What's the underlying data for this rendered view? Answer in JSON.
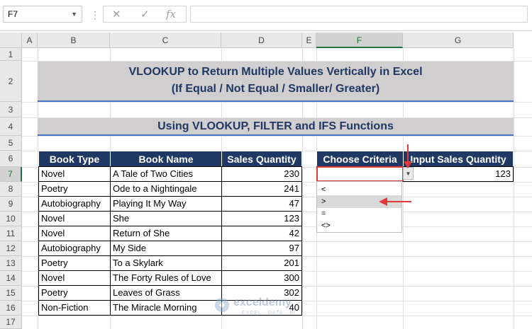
{
  "formula_bar": {
    "name_box": "F7",
    "cancel_icon": "✕",
    "enter_icon": "✓",
    "function_icon": "fx",
    "formula": ""
  },
  "columns": [
    "A",
    "B",
    "C",
    "D",
    "E",
    "F",
    "G"
  ],
  "rows": [
    "1",
    "2",
    "3",
    "4",
    "5",
    "6",
    "7",
    "8",
    "9",
    "10",
    "11",
    "12",
    "13",
    "14",
    "15",
    "16",
    "17"
  ],
  "title": {
    "line1": "VLOOKUP to Return Multiple Values Vertically in Excel",
    "line2": "(If Equal / Not Equal / Smaller/ Greater)"
  },
  "subtitle": "Using VLOOKUP, FILTER and IFS Functions",
  "table": {
    "headers": [
      "Book Type",
      "Book Name",
      "Sales Quantity"
    ],
    "rows": [
      [
        "Novel",
        "A Tale of Two Cities",
        "230"
      ],
      [
        "Poetry",
        "Ode to a Nightingale",
        "241"
      ],
      [
        "Autobiography",
        "Playing It My Way",
        "47"
      ],
      [
        "Novel",
        "She",
        "123"
      ],
      [
        "Novel",
        "Return of She",
        "42"
      ],
      [
        "Autobiography",
        "My Side",
        "97"
      ],
      [
        "Poetry",
        "To a Skylark",
        "201"
      ],
      [
        "Novel",
        "The Forty Rules of Love",
        "300"
      ],
      [
        "Poetry",
        "Leaves of Grass",
        "302"
      ],
      [
        "Non-Fiction",
        "The Miracle Morning",
        "40"
      ]
    ]
  },
  "criteria": {
    "header_criteria": "Choose Criteria",
    "header_quantity": "Input Sales Quantity",
    "criteria_value": "",
    "quantity_value": "123",
    "options": [
      "<",
      ">",
      "=",
      "<>"
    ],
    "highlighted_option": ">"
  },
  "watermark": {
    "name": "exceldemy",
    "tagline": "EXCEL · DATA · BI"
  },
  "colors": {
    "header_fill": "#1f3864",
    "banner_fill": "#d0cece",
    "accent_red": "#e03a3a",
    "excel_green": "#217346"
  }
}
